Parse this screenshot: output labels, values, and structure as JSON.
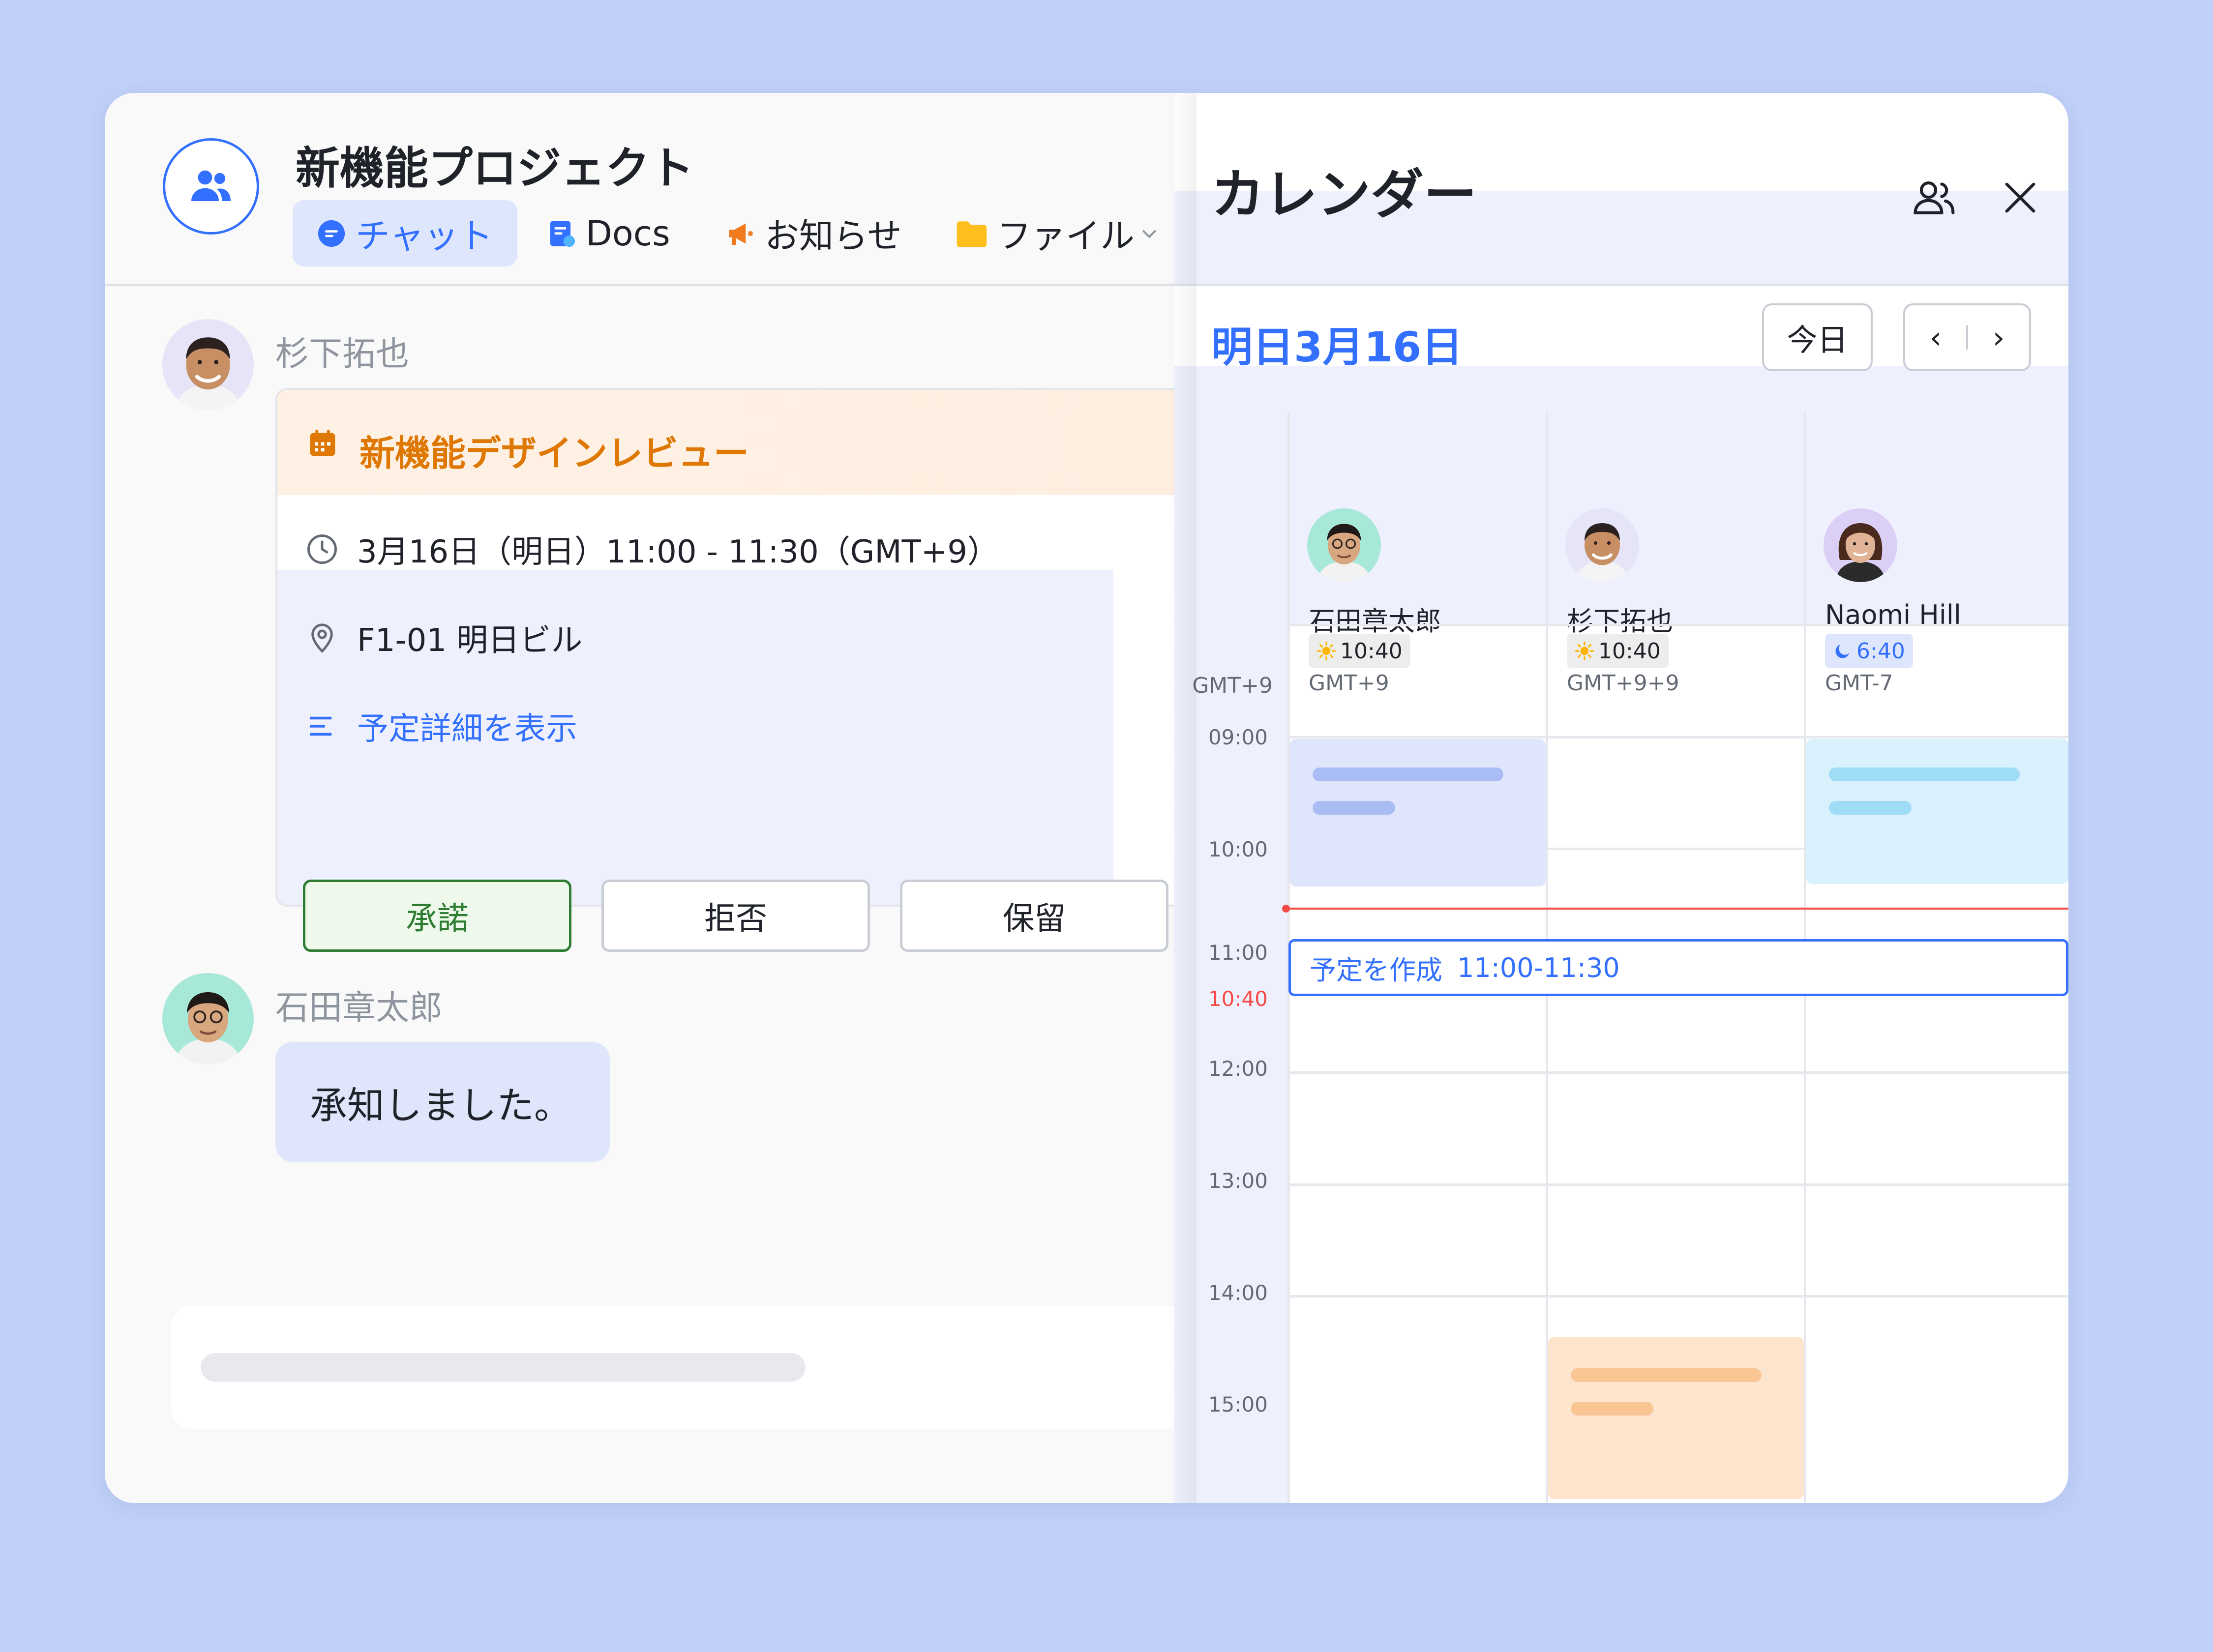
{
  "chat": {
    "group_name": "新機能プロジェクト",
    "tabs": [
      {
        "label": "チャット",
        "icon": "chat-bubble-icon"
      },
      {
        "label": "Docs",
        "icon": "docs-icon"
      },
      {
        "label": "お知らせ",
        "icon": "megaphone-icon"
      },
      {
        "label": "ファイル",
        "icon": "folder-icon"
      }
    ],
    "messages": [
      {
        "sender": "杉下拓也",
        "event": {
          "title": "新機能デザインレビュー",
          "time": "3月16日（明日）11:00 - 11:30（GMT+9）",
          "location": "F1-01 明日ビル",
          "details_link": "予定詳細を表示",
          "buttons": {
            "accept": "承諾",
            "decline": "拒否",
            "tentative": "保留"
          }
        }
      },
      {
        "sender": "石田章太郎",
        "text": "承知しました。"
      }
    ]
  },
  "calendar": {
    "title": "カレンダー",
    "date_label": "明日3月16日",
    "today_button": "今日",
    "nav_prev": "‹",
    "nav_next": "›",
    "gutter_timezone": "GMT+9",
    "now_time": "10:40",
    "hours": [
      "09:00",
      "10:00",
      "11:00",
      "12:00",
      "13:00",
      "14:00",
      "15:00"
    ],
    "people": [
      {
        "name": "石田章太郎",
        "local_time": "10:40",
        "time_icon": "sun-icon",
        "timezone": "GMT+9"
      },
      {
        "name": "杉下拓也",
        "local_time": "10:40",
        "time_icon": "sun-icon",
        "timezone": "GMT+9+9"
      },
      {
        "name": "Naomi Hill",
        "local_time": "6:40",
        "time_icon": "moon-icon",
        "timezone": "GMT-7"
      }
    ],
    "new_event": {
      "label": "予定を作成",
      "time": "11:00-11:30"
    }
  },
  "colors": {
    "accent": "#3370ff",
    "event_orange": "#de7802",
    "accept_green": "#2e7d32",
    "now_red": "#f54a45",
    "page_background": "#c0d0f8"
  }
}
